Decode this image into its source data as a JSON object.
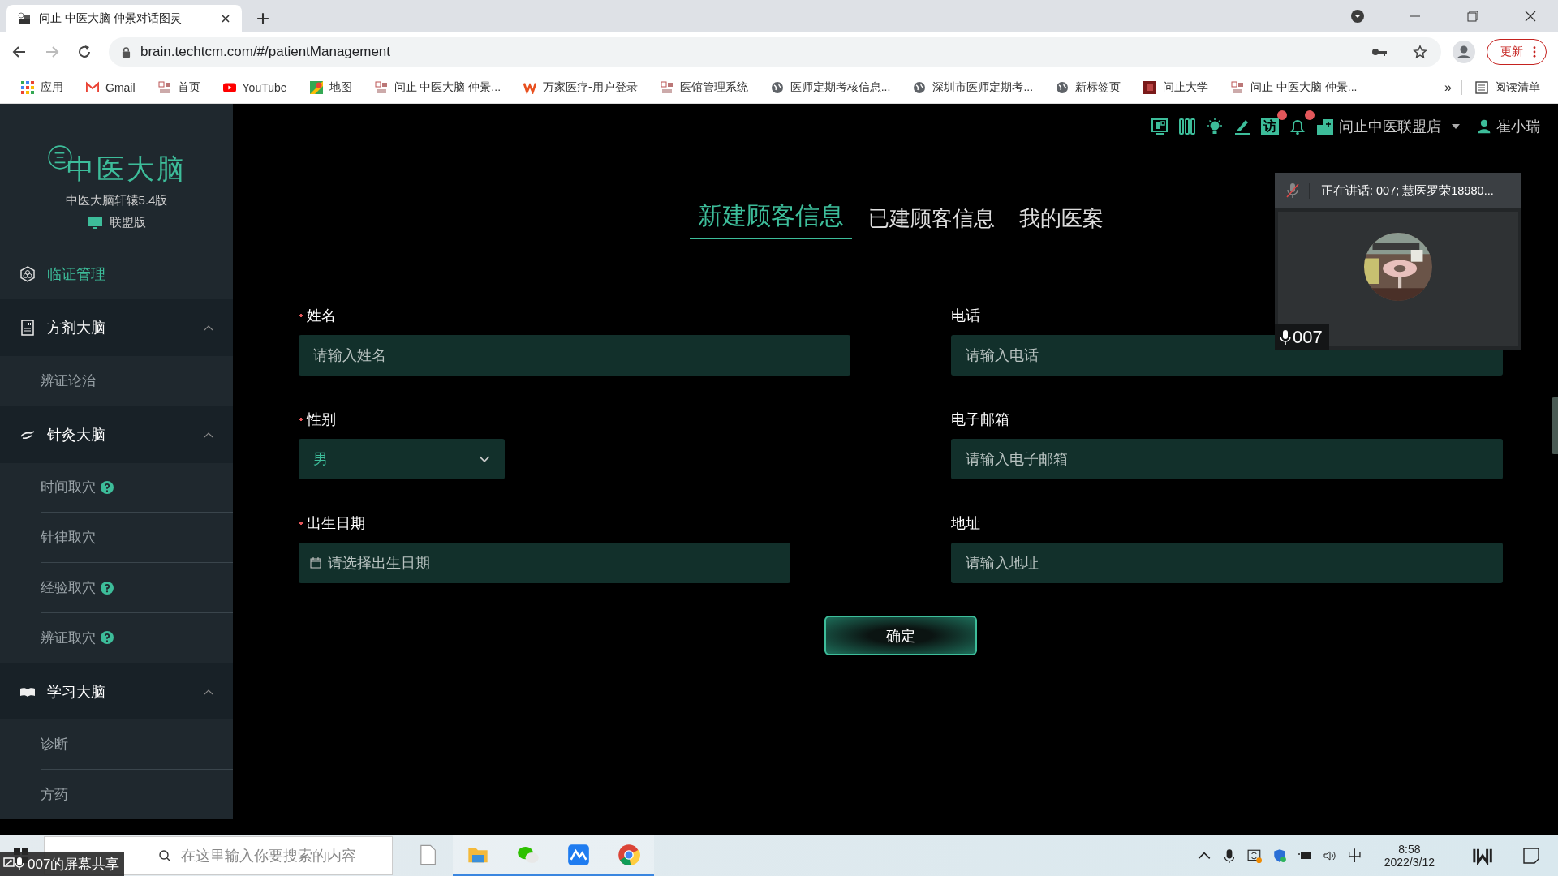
{
  "browser": {
    "tab_title": "问止 中医大脑 仲景对话图灵",
    "url": "brain.techtcm.com/#/patientManagement",
    "update_button": "更新",
    "bookmarks": [
      {
        "label": "应用",
        "kind": "apps"
      },
      {
        "label": "Gmail",
        "kind": "gmail"
      },
      {
        "label": "首页",
        "kind": "site"
      },
      {
        "label": "YouTube",
        "kind": "youtube"
      },
      {
        "label": "地图",
        "kind": "maps"
      },
      {
        "label": "问止 中医大脑 仲景...",
        "kind": "site"
      },
      {
        "label": "万家医疗-用户登录",
        "kind": "w"
      },
      {
        "label": "医馆管理系统",
        "kind": "site"
      },
      {
        "label": "医师定期考核信息...",
        "kind": "globe"
      },
      {
        "label": "深圳市医师定期考...",
        "kind": "globe"
      },
      {
        "label": "新标签页",
        "kind": "globe"
      },
      {
        "label": "问止大学",
        "kind": "book"
      },
      {
        "label": "问止 中医大脑 仲景...",
        "kind": "site"
      }
    ],
    "overflow": "»",
    "reading_list": "阅读清单"
  },
  "sidebar": {
    "logo": "中医大脑",
    "version": "中医大脑轩辕5.4版",
    "edition": "联盟版",
    "nav": [
      {
        "kind": "link",
        "label": "临证管理",
        "selected": true
      },
      {
        "kind": "group",
        "label": "方剂大脑",
        "expanded": true,
        "children": [
          {
            "label": "辨证论治",
            "help": false,
            "selected": false
          }
        ]
      },
      {
        "kind": "group",
        "label": "针灸大脑",
        "expanded": true,
        "children": [
          {
            "label": "时间取穴",
            "help": true,
            "selected": false
          },
          {
            "label": "针律取穴",
            "help": false,
            "selected": false
          },
          {
            "label": "经验取穴",
            "help": true,
            "selected": false
          },
          {
            "label": "辨证取穴",
            "help": true,
            "selected": false
          }
        ]
      },
      {
        "kind": "group",
        "label": "学习大脑",
        "expanded": true,
        "children": [
          {
            "label": "诊断",
            "help": false,
            "selected": false
          },
          {
            "label": "方药",
            "help": false,
            "selected": false
          }
        ]
      }
    ]
  },
  "header": {
    "icons": [
      {
        "kind": "monitor",
        "badge": false
      },
      {
        "kind": "books",
        "badge": false
      },
      {
        "kind": "bulb",
        "badge": false
      },
      {
        "kind": "pen",
        "badge": false
      },
      {
        "kind": "glyph",
        "label": "访",
        "badge": true
      },
      {
        "kind": "bell",
        "badge": true
      }
    ],
    "store": "问止中医联盟店",
    "user": "崔小瑞"
  },
  "tabs": [
    {
      "label": "新建顾客信息",
      "selected": true
    },
    {
      "label": "已建顾客信息",
      "selected": false
    },
    {
      "label": "我的医案",
      "selected": false
    }
  ],
  "form": {
    "fields": [
      {
        "label": "姓名",
        "required": true,
        "kind": "text",
        "placeholder": "请输入姓名"
      },
      {
        "label": "电话",
        "required": false,
        "kind": "text",
        "placeholder": "请输入电话"
      },
      {
        "label": "性别",
        "required": true,
        "kind": "select",
        "value": "男"
      },
      {
        "label": "电子邮箱",
        "required": false,
        "kind": "text",
        "placeholder": "请输入电子邮箱"
      },
      {
        "label": "出生日期",
        "required": true,
        "kind": "date",
        "placeholder": "请选择出生日期"
      },
      {
        "label": "地址",
        "required": false,
        "kind": "text",
        "placeholder": "请输入地址"
      }
    ],
    "submit": "确定"
  },
  "video_call": {
    "speaking": "正在讲话: 007; 慧医罗荣18980...",
    "muted": true,
    "name": "007"
  },
  "taskbar": {
    "share_label": "007的屏幕共享",
    "search_placeholder": "在这里输入你要搜索的内容",
    "apps": [
      {
        "kind": "file",
        "active": false
      },
      {
        "kind": "folder",
        "active": true
      },
      {
        "kind": "wechat",
        "active": true
      },
      {
        "kind": "lark",
        "active": true
      },
      {
        "kind": "chrome",
        "active": true
      }
    ],
    "ime": "中",
    "time": "8:58",
    "date": "2022/3/12"
  }
}
